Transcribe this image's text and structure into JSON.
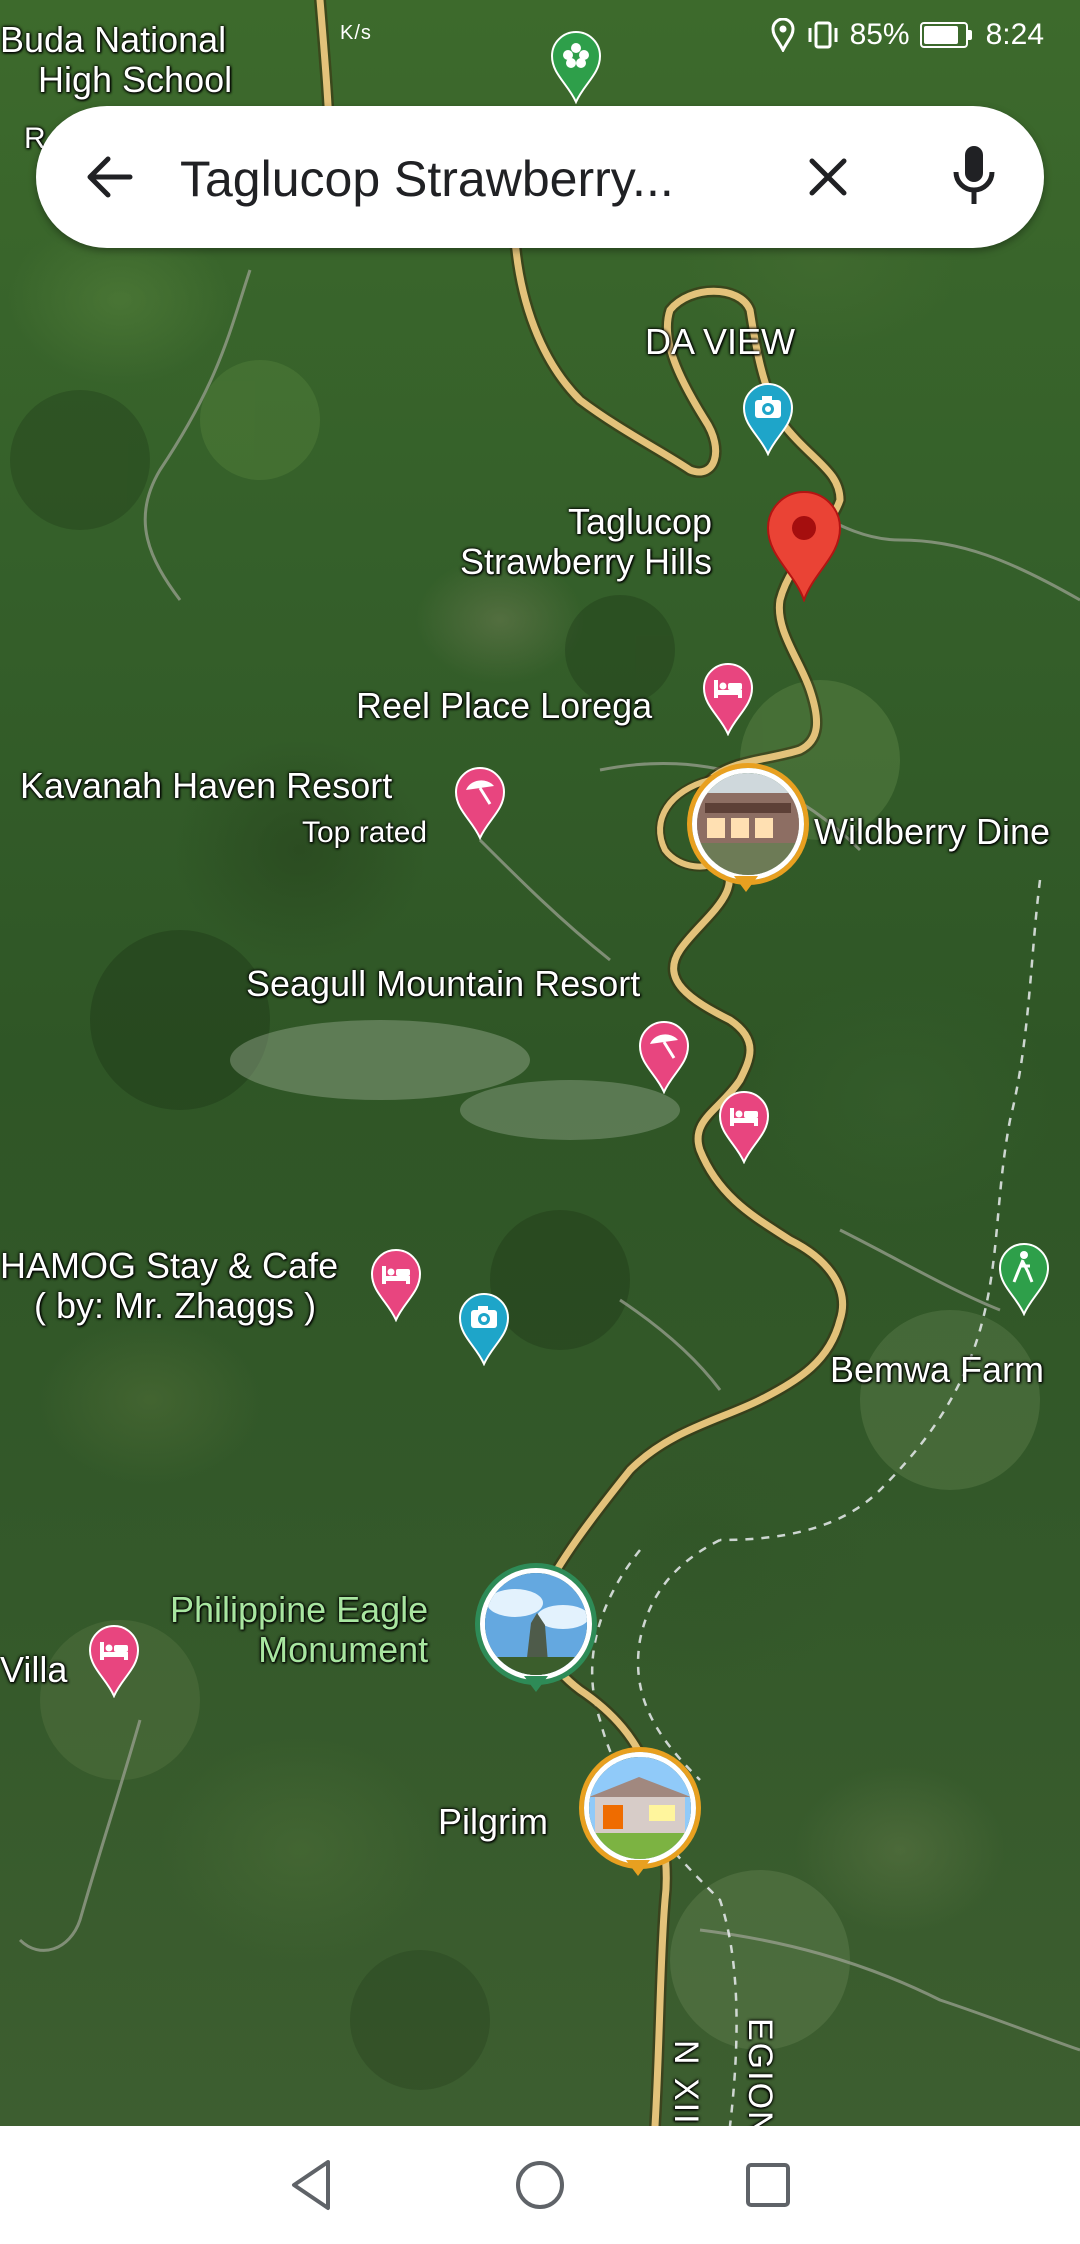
{
  "status_bar": {
    "left_text": "K/s",
    "battery": "85%",
    "battery_level": 0.85,
    "time": "8:24"
  },
  "search": {
    "query": "Taglucop Strawberry..."
  },
  "labels": {
    "buda_line1": "Buda National",
    "buda_line2": "High School",
    "buda_extra": "R",
    "da_view": "DA VIEW",
    "taglucop_line1": "Taglucop",
    "taglucop_line2": "Strawberry Hills",
    "reel_place": "Reel Place Lorega",
    "kavanah": "Kavanah Haven Resort",
    "kavanah_sub": "Top rated",
    "wildberry": "Wildberry Dine",
    "seagull": "Seagull Mountain Resort",
    "hamog_line1": "HAMOG Stay & Cafe",
    "hamog_line2": "( by: Mr. Zhaggs )",
    "bemwa": "Bemwa Farm",
    "eagle_line1": "Philippine Eagle",
    "eagle_line2": "Monument",
    "villa": "Villa",
    "pilgrim": "Pilgrim",
    "road_xii": "N XII",
    "region": "EGION"
  },
  "colors": {
    "road": "#e3c27a",
    "pin_red": "#ea4335",
    "pin_pink": "#e8457f",
    "pin_blue": "#1ea5c9",
    "pin_green": "#2e9f4a",
    "photo_ring_orange": "#e8a020"
  }
}
